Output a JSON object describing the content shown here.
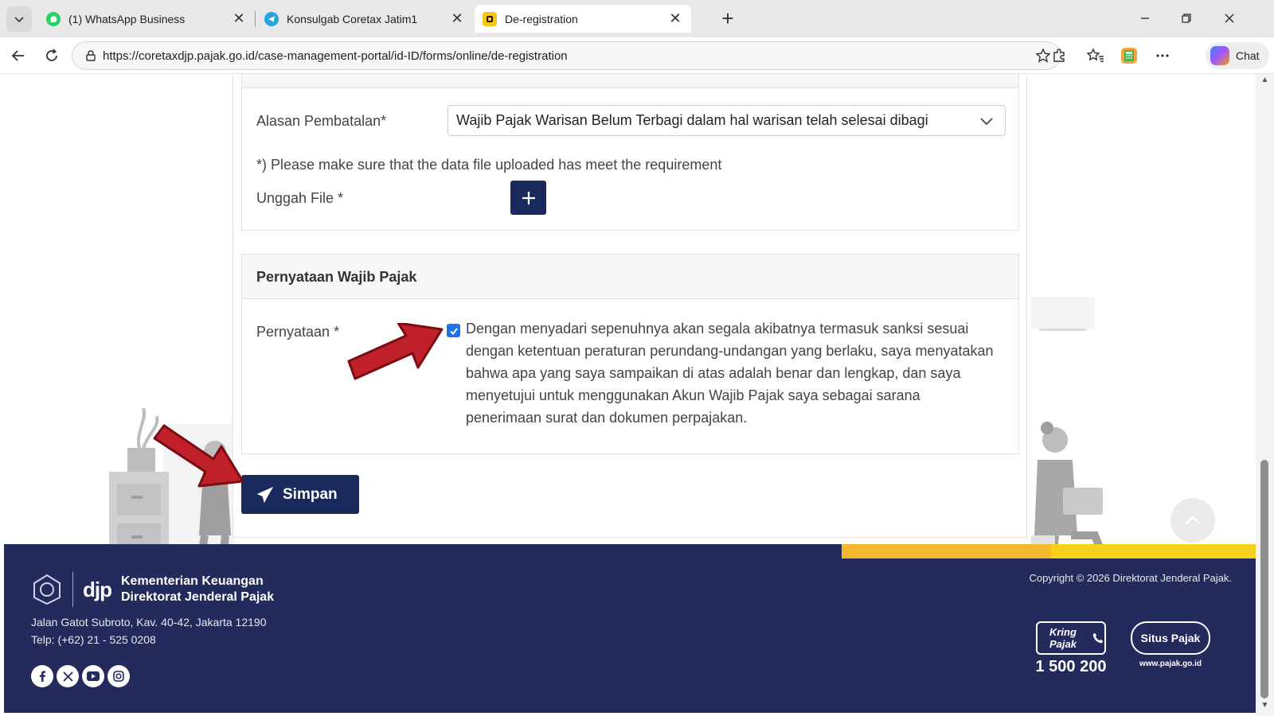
{
  "browser": {
    "tabs": [
      {
        "title": "(1) WhatsApp Business",
        "icon": "whatsapp-icon",
        "color": "#25d366"
      },
      {
        "title": "Konsulgab Coretax Jatim1",
        "icon": "telegram-icon",
        "color": "#2aa3df"
      },
      {
        "title": "De-registration",
        "icon": "coretax-icon",
        "color": "#f5c518",
        "active": true
      }
    ],
    "url": "https://coretaxdjp.pajak.go.id/case-management-portal/id-ID/forms/online/de-registration",
    "chat_label": "Chat"
  },
  "form": {
    "reason_label": "Alasan Pembatalan*",
    "reason_value": "Wajib Pajak Warisan Belum Terbagi dalam hal warisan telah selesai dibagi",
    "note": "*) Please make sure that the data file uploaded has meet the requirement",
    "upload_label": "Unggah File *",
    "statement_section_title": "Pernyataan Wajib Pajak",
    "statement_label": "Pernyataan *",
    "statement_checked": true,
    "statement_text": "Dengan menyadari sepenuhnya akan segala akibatnya termasuk sanksi sesuai dengan ketentuan peraturan perundang-undangan yang berlaku, saya menyatakan bahwa apa yang saya sampaikan di atas adalah benar dan lengkap, dan saya menyetujui untuk menggunakan Akun Wajib Pajak saya sebagai sarana penerimaan surat dan dokumen perpajakan.",
    "submit_label": "Simpan"
  },
  "footer": {
    "brand": "djp",
    "org_line1": "Kementerian Keuangan",
    "org_line2": "Direktorat Jenderal Pajak",
    "address": "Jalan Gatot Subroto, Kav. 40-42, Jakarta 12190",
    "phone": "Telp: (+62) 21 - 525 0208",
    "copyright": "Copyright © 2026 Direktorat Jenderal Pajak.",
    "kring_label": "Kring Pajak",
    "kring_number": "1 500 200",
    "situs_label": "Situs Pajak",
    "situs_url": "www.pajak.go.id"
  },
  "colors": {
    "primary": "#1b2a5c",
    "footer_bg": "#232a5c",
    "annotation_arrow": "#c0202a",
    "checkbox": "#1a73e8"
  }
}
